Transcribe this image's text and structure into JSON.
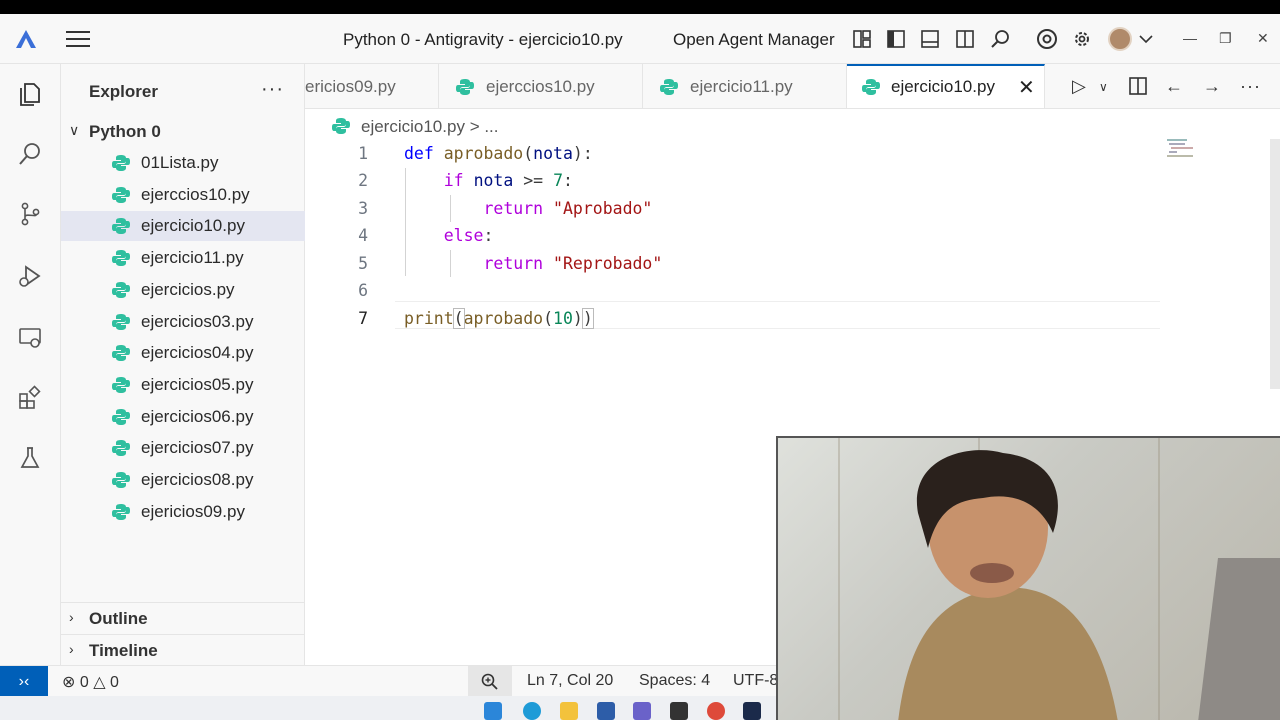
{
  "window": {
    "title": "Python 0 - Antigravity - ejercicio10.py",
    "agent_manager": "Open Agent Manager"
  },
  "explorer": {
    "title": "Explorer",
    "more": "···",
    "folder": "Python 0",
    "files": [
      {
        "name": "01Lista.py"
      },
      {
        "name": "ejerccios10.py"
      },
      {
        "name": "ejercicio10.py"
      },
      {
        "name": "ejercicio11.py"
      },
      {
        "name": "ejercicios.py"
      },
      {
        "name": "ejercicios03.py"
      },
      {
        "name": "ejercicios04.py"
      },
      {
        "name": "ejercicios05.py"
      },
      {
        "name": "ejercicios06.py"
      },
      {
        "name": "ejercicios07.py"
      },
      {
        "name": "ejercicios08.py"
      },
      {
        "name": "ejericios09.py"
      }
    ],
    "active_file": "ejercicio10.py",
    "outline": "Outline",
    "timeline": "Timeline"
  },
  "tabs": [
    {
      "label": "ericios09.py"
    },
    {
      "label": "ejerccios10.py"
    },
    {
      "label": "ejercicio11.py"
    },
    {
      "label": "ejercicio10.py",
      "active": true
    }
  ],
  "editor": {
    "breadcrumb_file": "ejercicio10.py",
    "breadcrumb_more": "> ...",
    "line_numbers": [
      "1",
      "2",
      "3",
      "4",
      "5",
      "6",
      "7"
    ],
    "current_line": 7
  },
  "statusbar": {
    "errors": "0",
    "warnings": "0",
    "position": "Ln 7, Col 20",
    "spaces": "Spaces: 4",
    "encoding": "UTF-8"
  },
  "colors": {
    "accent": "#005fb8",
    "python_icon": "#2fbf9f",
    "keyword": "#0000ff",
    "string": "#a31515",
    "number": "#098658"
  }
}
